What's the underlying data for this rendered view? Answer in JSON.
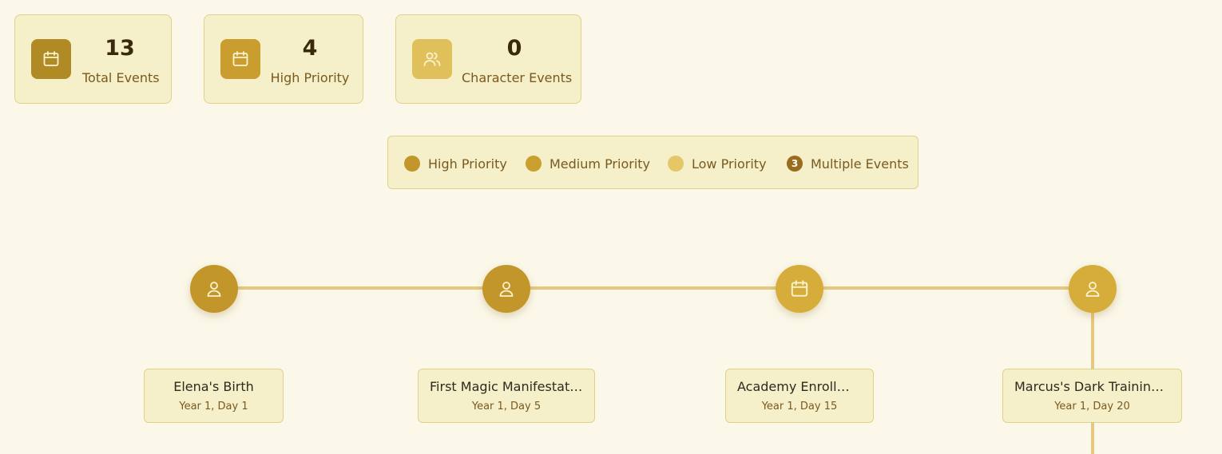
{
  "stats": [
    {
      "value": "13",
      "label": "Total Events",
      "icon": "calendar-icon",
      "color": "#b08a24"
    },
    {
      "value": "4",
      "label": "High Priority",
      "icon": "calendar-icon",
      "color": "#c99e2e"
    },
    {
      "value": "0",
      "label": "Character Events",
      "icon": "users-icon",
      "color": "#e0c05a"
    }
  ],
  "legend": {
    "high": {
      "label": "High Priority",
      "color": "#c2962a"
    },
    "medium": {
      "label": "Medium Priority",
      "color": "#c9a030"
    },
    "low": {
      "label": "Low Priority",
      "color": "#e5c767"
    },
    "multiple": {
      "label": "Multiple Events",
      "count": "3",
      "color": "#9a6c1e"
    }
  },
  "timeline": {
    "line_color": "#e6c87e",
    "events": [
      {
        "title": "Elena's Birth",
        "date": "Year 1, Day 1",
        "icon": "user-icon",
        "color": "#c2962a"
      },
      {
        "title": "First Magic Manifestation",
        "date": "Year 1, Day 5",
        "icon": "user-icon",
        "color": "#c2962a"
      },
      {
        "title": "Academy Enrollment",
        "date": "Year 1, Day 15",
        "icon": "calendar-icon",
        "color": "#d6ad3a"
      },
      {
        "title": "Marcus's Dark Training ...",
        "date": "Year 1, Day 20",
        "icon": "user-icon",
        "color": "#d6ad3a"
      }
    ]
  }
}
